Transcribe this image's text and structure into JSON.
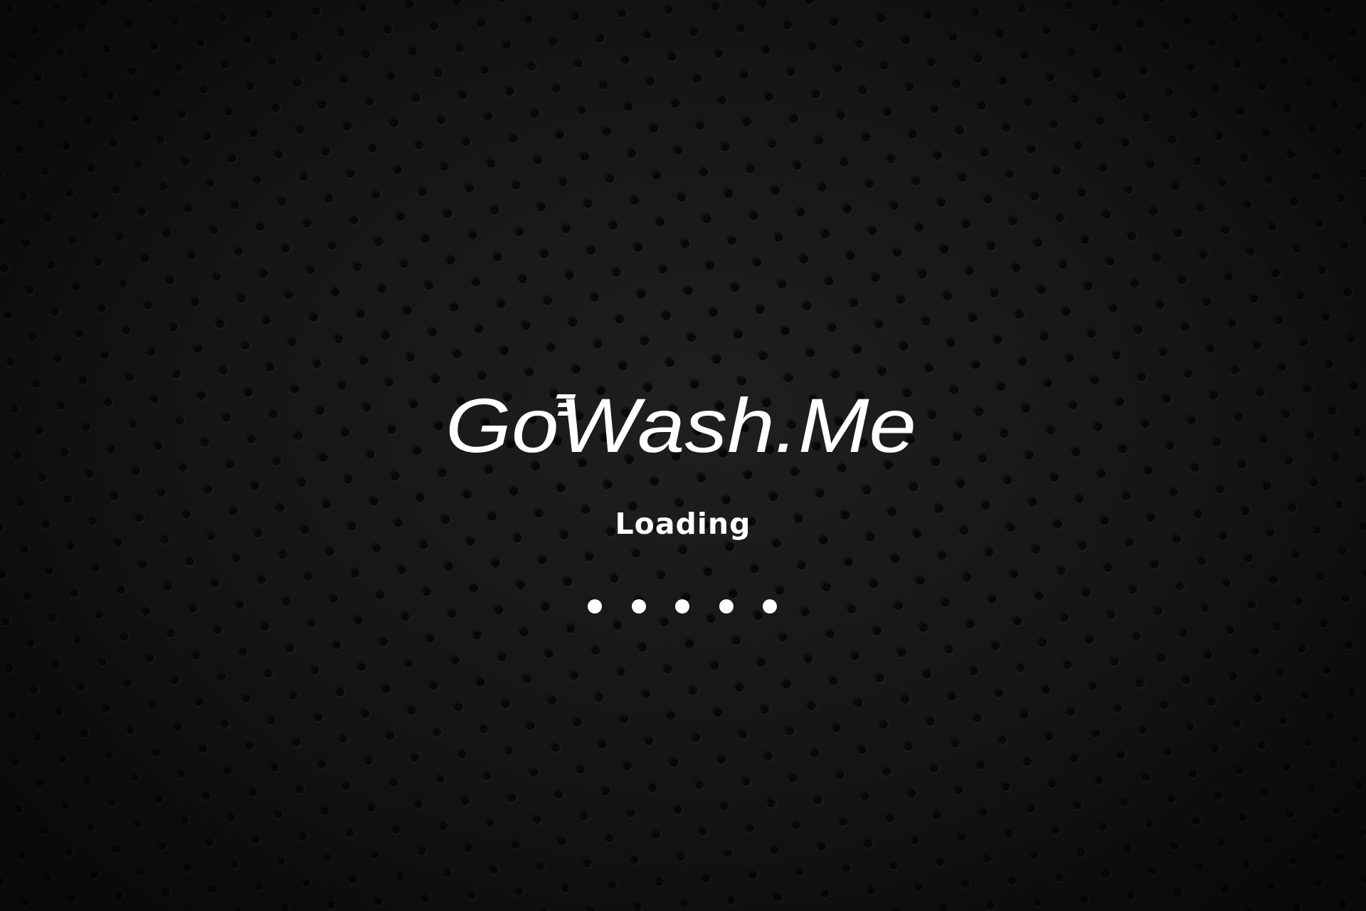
{
  "app": {
    "logo_text": "GoWash.Me"
  },
  "loader": {
    "label": "Loading",
    "dot_count": 5
  },
  "colors": {
    "background": "#141414",
    "perforation": "#090909",
    "foreground": "#ffffff"
  },
  "icons": {
    "logo": "gowashme-wordmark"
  }
}
